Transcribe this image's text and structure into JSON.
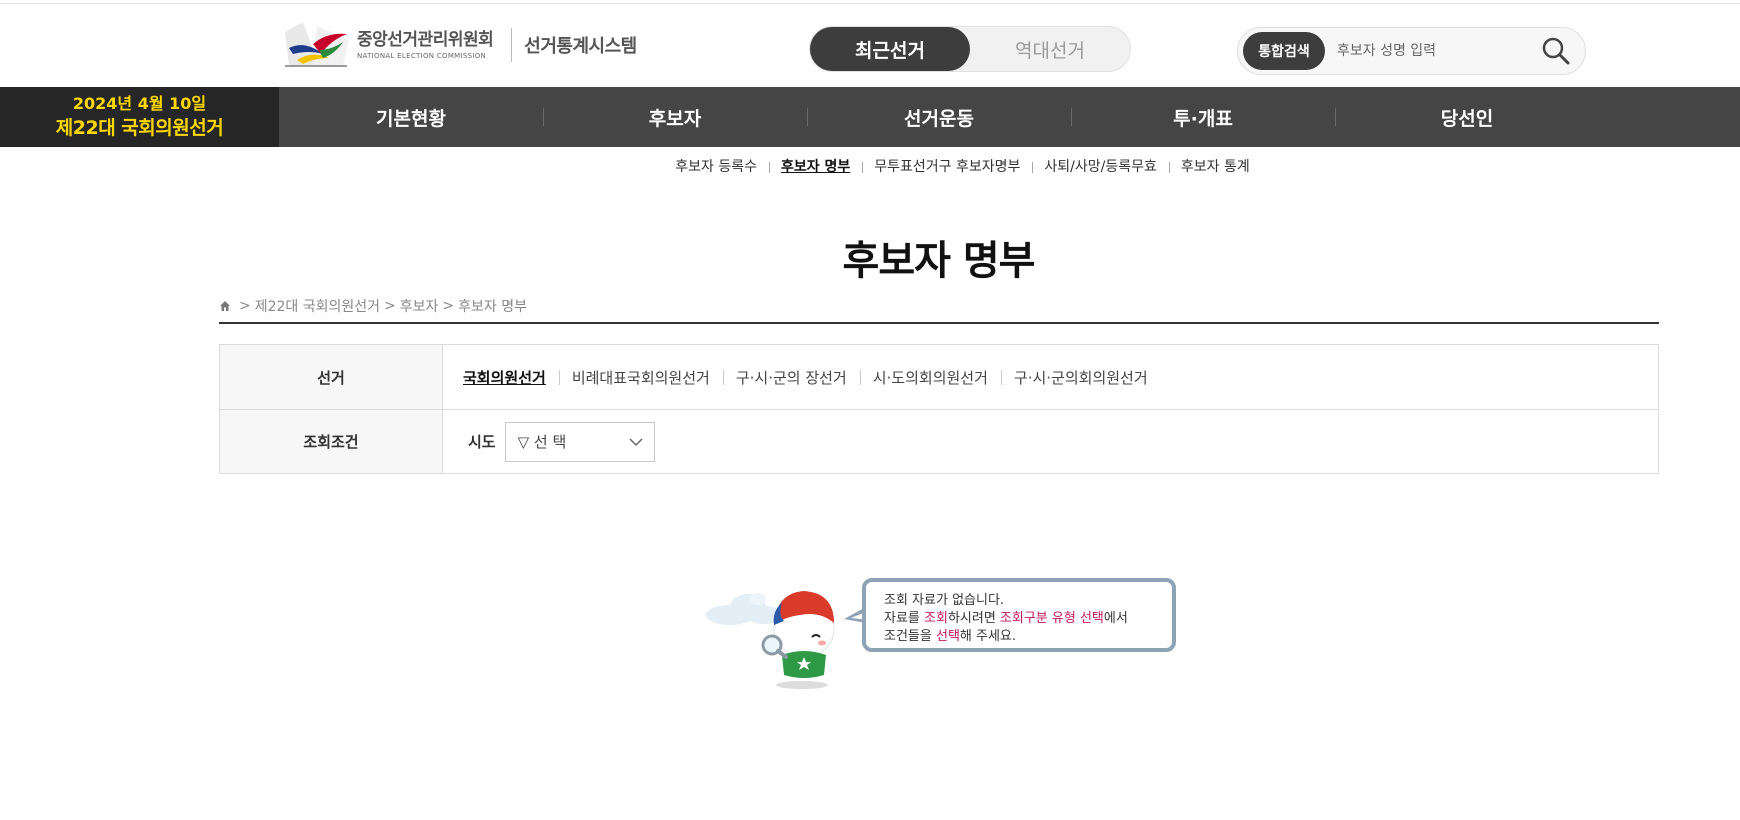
{
  "header": {
    "org_name": "중앙선거관리위원회",
    "org_name_en": "NATIONAL ELECTION COMMISSION",
    "system_name": "선거통계시스템",
    "toggle": {
      "recent": "최근선거",
      "past": "역대선거"
    },
    "search": {
      "chip_label": "통합검색",
      "placeholder": "후보자 성명 입력",
      "icon": "search-icon"
    }
  },
  "election_badge": {
    "date": "2024년 4월 10일",
    "name": "제22대 국회의원선거",
    "color": "#ffd800"
  },
  "nav": {
    "items": [
      "기본현황",
      "후보자",
      "선거운동",
      "투·개표",
      "당선인"
    ]
  },
  "subnav": {
    "items": [
      "후보자 등록수",
      "후보자 명부",
      "무투표선거구 후보자명부",
      "사퇴/사망/등록무효",
      "후보자 통계"
    ],
    "current": "후보자 명부"
  },
  "page": {
    "title": "후보자 명부"
  },
  "breadcrumb": {
    "home_icon": "home-icon",
    "items": [
      "제22대 국회의원선거",
      "후보자",
      "후보자 명부"
    ],
    "separator": ">"
  },
  "filter": {
    "election_label": "선거",
    "election_types": [
      "국회의원선거",
      "비례대표국회의원선거",
      "구·시·군의 장선거",
      "시·도의회의원선거",
      "구·시·군의회의원선거"
    ],
    "current_type": "국회의원선거",
    "condition_label": "조회조건",
    "sido_label": "시도",
    "sido_value": "▽ 선 택"
  },
  "empty_state": {
    "line1": "조회 자료가 없습니다.",
    "line2_a": "자료를 ",
    "line2_b": "조회",
    "line2_c": "하시려면 ",
    "line2_d": "조회구분 유형 선택",
    "line2_e": "에서",
    "line3_a": "조건들을 ",
    "line3_b": "선택",
    "line3_c": "해 주세요.",
    "highlight_color": "#c2185b"
  }
}
